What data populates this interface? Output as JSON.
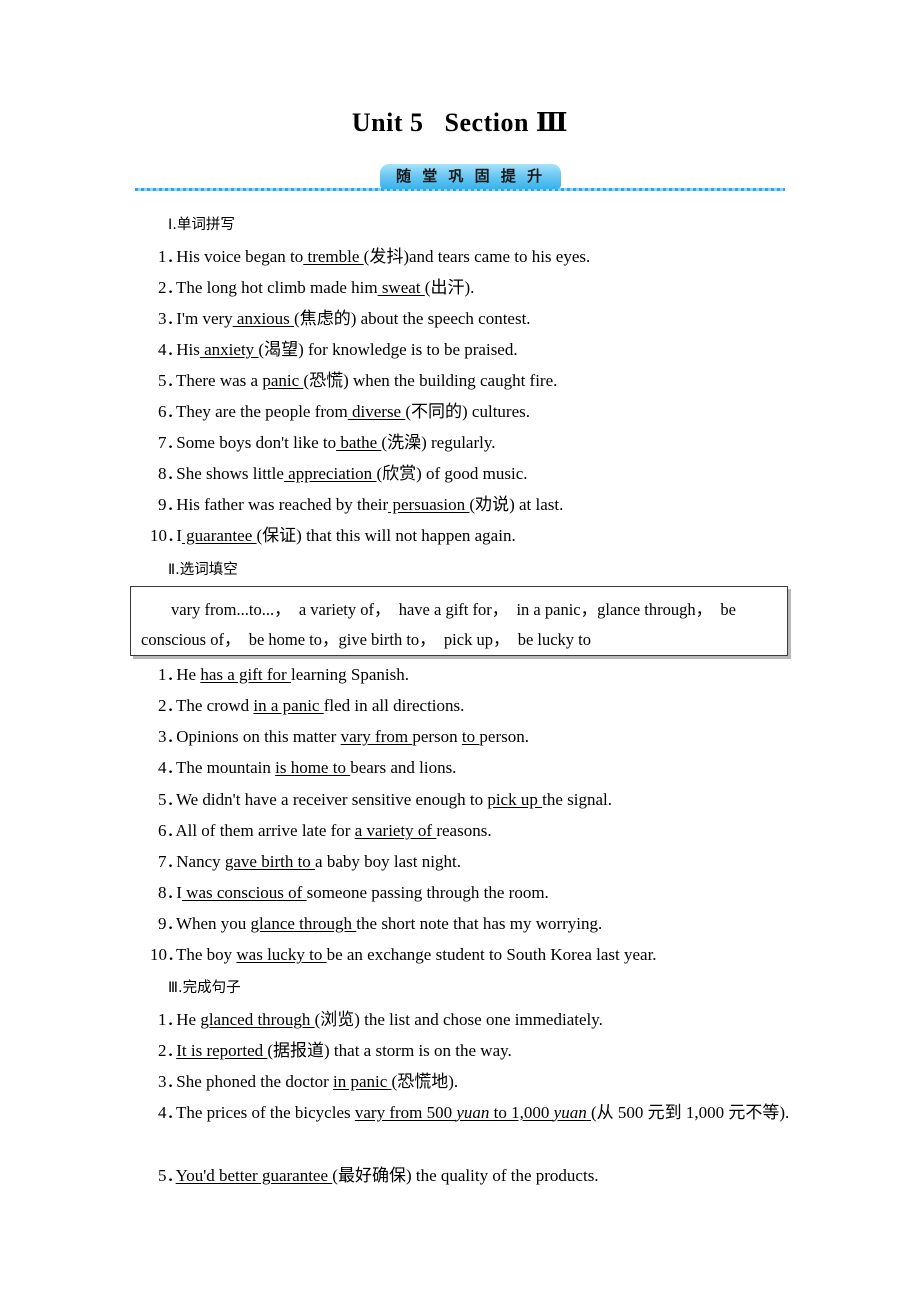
{
  "title": {
    "unit": "Unit 5",
    "section_label": "Section",
    "section_number": "Ⅲ"
  },
  "badge": {
    "label": "随 堂 巩 固 提 升"
  },
  "sections": [
    {
      "heading": "Ⅰ.单词拼写",
      "items": [
        {
          "num": "1．",
          "pre": "His voice began to",
          "blank": "  tremble  ",
          "post": "(发抖)and tears came to his eyes."
        },
        {
          "num": "2．",
          "pre": "The long hot climb made him",
          "blank": "  sweat  ",
          "post": "(出汗)."
        },
        {
          "num": "3．",
          "pre": "I'm very",
          "blank": "  anxious  ",
          "post": "(焦虑的) about the speech contest."
        },
        {
          "num": "4．",
          "pre": "His",
          "blank": "  anxiety  ",
          "post": "(渴望) for knowledge is to be praised."
        },
        {
          "num": "5．",
          "pre": "There was a ",
          "blank": "  panic  ",
          "post": "(恐慌) when the building caught fire."
        },
        {
          "num": "6．",
          "pre": "They are the people from",
          "blank": "  diverse  ",
          "post": "(不同的) cultures."
        },
        {
          "num": "7．",
          "pre": "Some boys don't like to",
          "blank": "  bathe  ",
          "post": "(洗澡) regularly."
        },
        {
          "num": "8．",
          "pre": "She shows little",
          "blank": "  appreciation  ",
          "post": "(欣赏) of good music."
        },
        {
          "num": "9．",
          "pre": "His father was reached by their",
          "blank": "  persuasion  ",
          "post": "(劝说) at last."
        },
        {
          "num": "10．",
          "pre": "I",
          "blank": "  guarantee  ",
          "post": "(保证) that this will not happen again."
        }
      ]
    },
    {
      "heading": "Ⅱ.选词填空",
      "wordbank": "vary from...to...，　a variety of，　have a gift for，　in a panic，glance through，　be conscious of，　be home to，give birth to，　pick up，　be lucky to",
      "items": [
        {
          "num": "1．",
          "pre": "He ",
          "blank": "  has a gift for  ",
          "post": " learning Spanish."
        },
        {
          "num": "2．",
          "pre": "The crowd ",
          "blank": "  in a panic  ",
          "post": " fled in all directions."
        },
        {
          "num": "3．",
          "pre": "Opinions on this matter ",
          "blank": "  vary from  ",
          "post": " person ",
          "blank2": "  to  ",
          "post2": " person."
        },
        {
          "num": "4．",
          "pre": "The mountain ",
          "blank": "  is home to  ",
          "post": " bears and lions."
        },
        {
          "num": "5．",
          "pre": "We didn't have a receiver sensitive enough to ",
          "blank": "  pick up  ",
          "post": " the signal."
        },
        {
          "num": "6．",
          "pre": "All of them arrive late for ",
          "blank": "  a variety of  ",
          "post": " reasons."
        },
        {
          "num": "7．",
          "pre": "Nancy ",
          "blank": "  gave birth to  ",
          "post": " a baby boy last night."
        },
        {
          "num": "8．",
          "pre": "I",
          "blank": "  was conscious of  ",
          "post": " someone passing through the room."
        },
        {
          "num": "9．",
          "pre": "When you ",
          "blank": "  glance through  ",
          "post": " the short note that has my worrying."
        },
        {
          "num": "10．",
          "pre": "The boy ",
          "blank": "  was lucky to  ",
          "post": " be an exchange student to South Korea last year."
        }
      ]
    },
    {
      "heading": "Ⅲ.完成句子",
      "items": [
        {
          "num": "1．",
          "pre": "He ",
          "blank": "  glanced through  ",
          "post": " (浏览) the list and chose one immediately."
        },
        {
          "num": "2．",
          "pre": "",
          "blank": "  It is reported  ",
          "post": "(据报道) that a storm is on the way."
        },
        {
          "num": "3．",
          "pre": "She phoned the doctor ",
          "blank": "  in panic  ",
          "post": "(恐慌地)."
        },
        {
          "num": "4．",
          "pre": "The prices of the bicycles ",
          "blank_pre": "  vary from 500 ",
          "blank_it1": "yuan",
          "blank_mid": " to 1,000 ",
          "blank_it2": "yuan",
          "blank_post": "  ",
          "post": "(从 500 元到 1,000 元不等)."
        },
        {
          "num": "5．",
          "pre": "",
          "blank": "  You'd better guarantee  ",
          "post": "(最好确保) the quality of the products."
        }
      ]
    }
  ]
}
